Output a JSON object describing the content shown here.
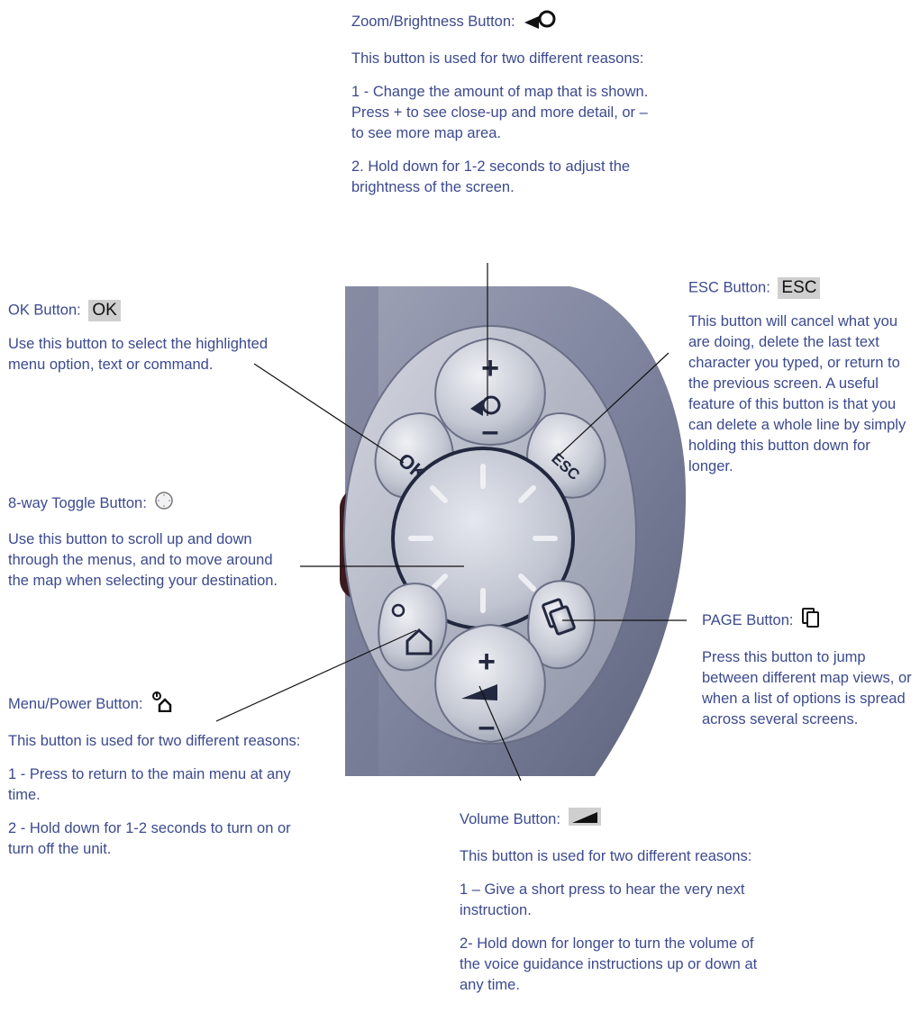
{
  "zoom": {
    "title": "Zoom/Brightness Button:",
    "intro": "This button is used for two different reasons:",
    "p1": "1 - Change the amount of map that is shown. Press + to see close-up and more detail, or – to see more map area.",
    "p2": "2. Hold down for 1-2 seconds to adjust  the brightness of the screen."
  },
  "ok": {
    "title": "OK Button:",
    "chip": "OK",
    "body": "Use this button to select the highlighted menu option, text or command."
  },
  "toggle": {
    "title": "8-way Toggle Button:",
    "body": "Use this button to scroll up and down through the menus, and to move around the map when selecting your destination."
  },
  "menu": {
    "title": "Menu/Power Button:",
    "intro": "This button is used for two different reasons:",
    "p1": "1 - Press to return to the main menu at any time.",
    "p2": "2 - Hold down for 1-2 seconds to turn on or turn off the unit."
  },
  "esc": {
    "title": "ESC Button:",
    "chip": "ESC",
    "body": "This button will cancel what you are doing, delete the last text character you typed, or return to the previous screen. A useful feature of this button is that you can delete a whole line by simply holding this button down for longer."
  },
  "page": {
    "title": "PAGE Button:",
    "body": "Press this button to jump between different map views, or when a list of options is spread across several screens."
  },
  "volume": {
    "title": "Volume Button:",
    "intro": "This button is used for two different reasons:",
    "p1": "1 – Give a short press to hear the very next instruction.",
    "p2": "2- Hold down for longer to turn the volume of the voice guidance instructions up or down at any time."
  },
  "device": {
    "plus_top": "+",
    "minus_top": "–",
    "ok_key": "OK",
    "esc_key": "ESC",
    "plus_bottom": "+",
    "minus_bottom": "–"
  },
  "colors": {
    "text": "#3c4a8e",
    "device_body": "#7d829b",
    "button_silver": "#c9ccd6"
  }
}
